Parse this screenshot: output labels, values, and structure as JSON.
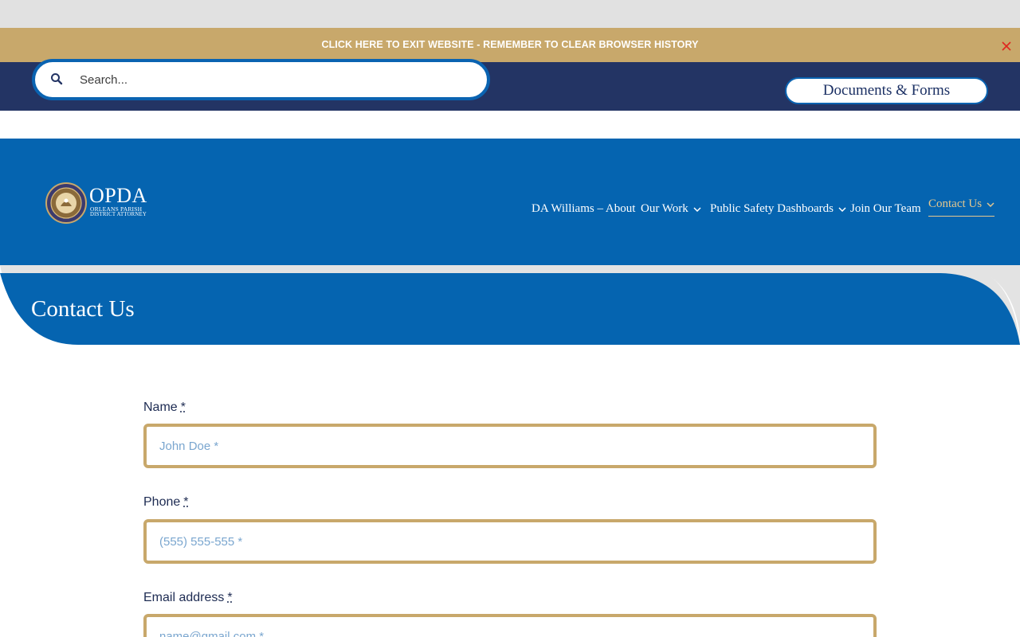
{
  "exit_bar": {
    "text": "CLICK HERE TO EXIT WEBSITE - REMEMBER TO CLEAR BROWSER HISTORY",
    "close_icon": "close-icon"
  },
  "search": {
    "placeholder": "Search...",
    "icon": "search-icon"
  },
  "header_button": {
    "label": "Documents & Forms"
  },
  "logo": {
    "title": "OPDA",
    "subtitle_line1": "ORLEANS PARISH",
    "subtitle_line2": "DISTRICT ATTORNEY"
  },
  "nav": {
    "items": [
      {
        "label": "DA Williams – About",
        "has_dropdown": false
      },
      {
        "label": "Our Work",
        "has_dropdown": true
      },
      {
        "label": "Public Safety Dashboards",
        "has_dropdown": true
      },
      {
        "label": "Join Our Team",
        "has_dropdown": false
      },
      {
        "label": "Contact Us",
        "has_dropdown": true,
        "active": true
      }
    ]
  },
  "page": {
    "title": "Contact Us"
  },
  "form": {
    "fields": [
      {
        "label": "Name",
        "required_mark": "*",
        "placeholder": "John Doe *"
      },
      {
        "label": "Phone",
        "required_mark": "*",
        "placeholder": "(555) 555-555 *"
      },
      {
        "label": "Email address",
        "required_mark": "*",
        "placeholder": "name@gmail.com *"
      }
    ]
  },
  "colors": {
    "gold": "#c8a86b",
    "navy": "#233464",
    "blue": "#0564b0",
    "active_nav": "#e4c78e"
  }
}
